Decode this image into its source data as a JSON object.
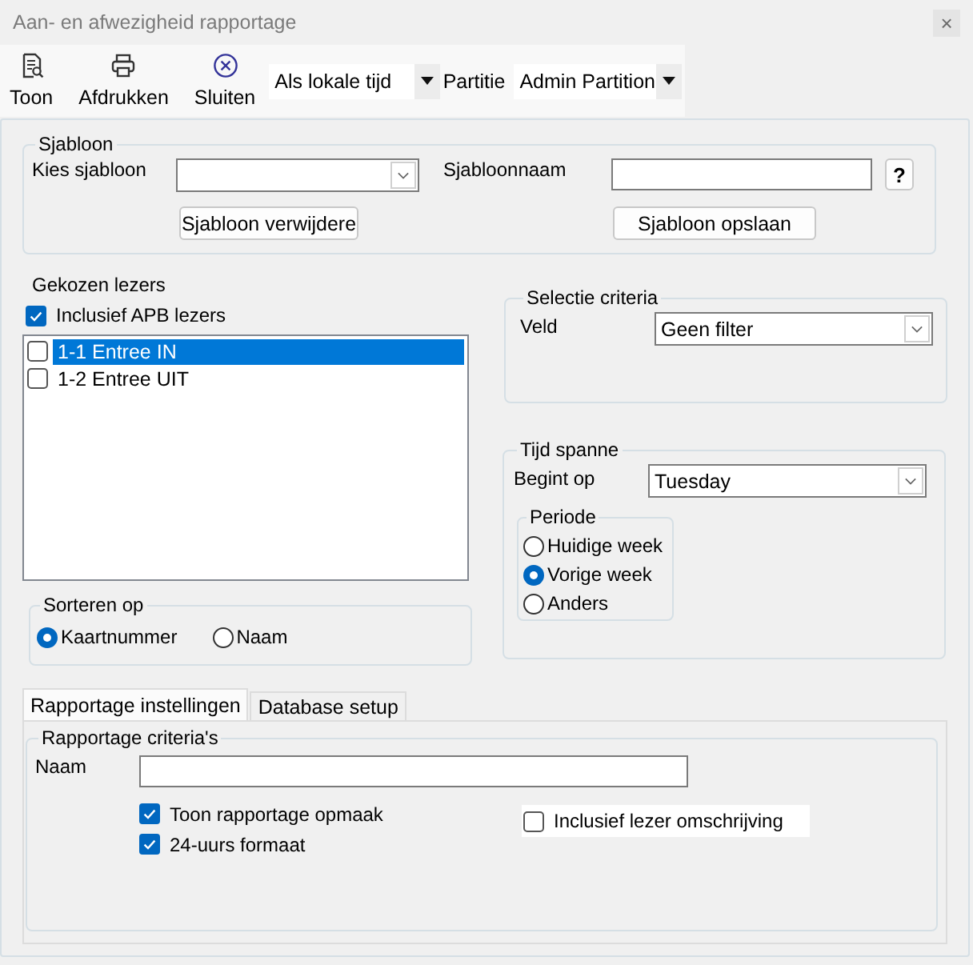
{
  "window": {
    "title": "Aan- en afwezigheid rapportage",
    "close": "×"
  },
  "toolbar": {
    "buttons": [
      {
        "label": "Toon",
        "kind": "report"
      },
      {
        "label": "Afdrukken",
        "kind": "printer"
      },
      {
        "label": "Sluiten",
        "kind": "close"
      }
    ],
    "time_mode": {
      "value": "Als lokale tijd"
    },
    "partition": {
      "label": "Partitie",
      "value": "Admin Partition"
    }
  },
  "template": {
    "title": "Sjabloon",
    "choose_label": "Kies sjabloon",
    "name_label": "Sjabloonnaam",
    "help": "?",
    "delete_button": "Sjabloon verwijdere",
    "save_button": "Sjabloon opslaan"
  },
  "readers": {
    "title": "Gekozen lezers",
    "include_apb": {
      "label": "Inclusief APB lezers",
      "checked": true
    },
    "items": [
      {
        "label": "1-1 Entree IN",
        "checked": false,
        "selected": true
      },
      {
        "label": "1-2 Entree UIT",
        "checked": false,
        "selected": false
      }
    ]
  },
  "sort": {
    "title": "Sorteren op",
    "options": [
      {
        "label": "Kaartnummer",
        "selected": true
      },
      {
        "label": "Naam",
        "selected": false
      }
    ]
  },
  "selection": {
    "title": "Selectie criteria",
    "field_label": "Veld",
    "field_value": "Geen filter"
  },
  "time_span": {
    "title": "Tijd spanne",
    "start_label": "Begint op",
    "start_value": "Tuesday",
    "period": {
      "title": "Periode",
      "options": [
        {
          "label": "Huidige week",
          "selected": false
        },
        {
          "label": "Vorige week",
          "selected": true
        },
        {
          "label": "Anders",
          "selected": false
        }
      ]
    }
  },
  "tabs": [
    {
      "label": "Rapportage instellingen",
      "selected": true
    },
    {
      "label": "Database setup",
      "selected": false
    }
  ],
  "report_criteria": {
    "title": "Rapportage criteria's",
    "name_label": "Naam",
    "options": [
      {
        "label": "Toon rapportage opmaak",
        "checked": true
      },
      {
        "label": "24-uurs formaat",
        "checked": true
      },
      {
        "label": "Inclusief lezer omschrijving",
        "checked": false
      }
    ]
  }
}
